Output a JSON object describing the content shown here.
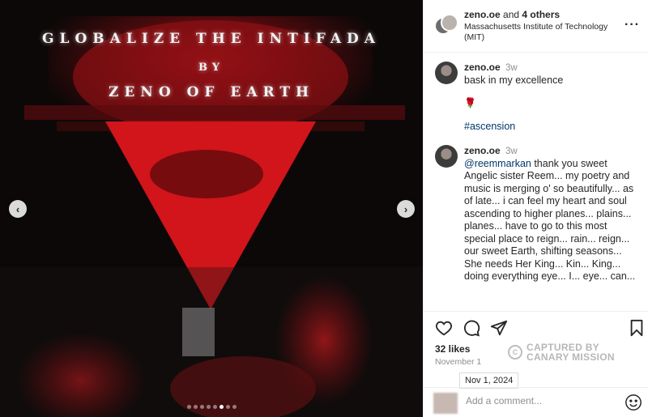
{
  "media": {
    "title_line1": "GLOBALIZE THE INTIFADA",
    "title_line2": "BY",
    "title_line3": "ZENO OF EARTH",
    "carousel_total": 8,
    "carousel_active": 6
  },
  "header": {
    "username": "zeno.oe",
    "and_text": "and",
    "others": "4 others",
    "location": "Massachusetts Institute of Technology (MIT)"
  },
  "comments": [
    {
      "user": "zeno.oe",
      "time": "3w",
      "text": "bask in my excellence",
      "emoji": "🌹",
      "hashtag": "#ascension"
    },
    {
      "user": "zeno.oe",
      "time": "3w",
      "mention": "@reemmarkan",
      "text": " thank you sweet Angelic sister Reem... my poetry and music is merging o' so beautifully... as of late... i can feel my heart and soul ascending to higher planes... plains... planes... have to go to this most special place to reign... rain... reign... our sweet Earth, shifting seasons... She needs Her King... Kin... King... doing everything eye... I... eye... can..."
    }
  ],
  "actions": {
    "likes": "32 likes",
    "date": "November 1",
    "tooltip": "Nov 1, 2024"
  },
  "stamp": {
    "line1": "CAPTURED BY",
    "line2": "CANARY MISSION"
  },
  "add_comment": {
    "placeholder": "Add a comment..."
  },
  "colors": {
    "accent_red": "#c8141c",
    "link_blue": "#00376b"
  }
}
